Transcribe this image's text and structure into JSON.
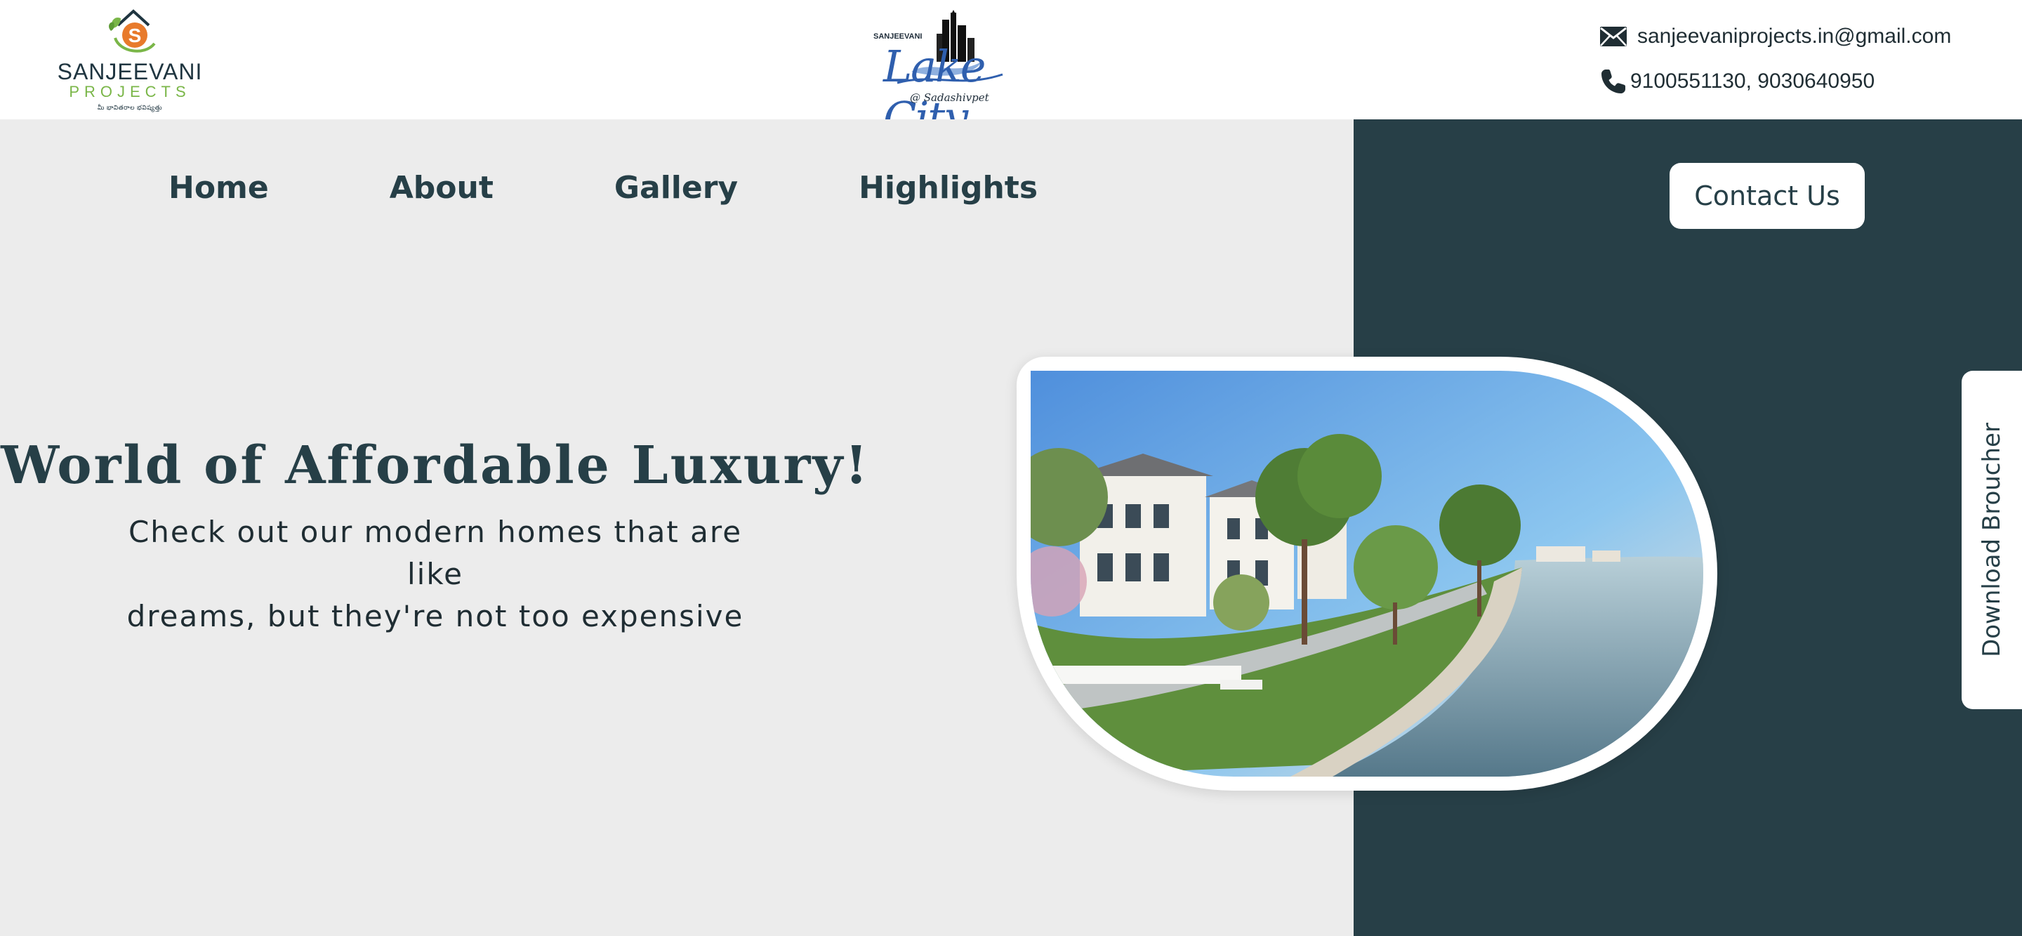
{
  "brand": {
    "name": "SANJEEVANI",
    "sub": "PROJECTS",
    "tagline": "మీ భావితరాల భవిష్యత్తు",
    "logo_letter": "S"
  },
  "project_logo": {
    "small": "SANJEEVANI",
    "main": "Lake City",
    "location": "@ Sadashivpet"
  },
  "contact_info": {
    "email": "sanjeevaniprojects.in@gmail.com",
    "phone": "9100551130, 9030640950",
    "email_icon": "mail-icon",
    "phone_icon": "phone-icon"
  },
  "nav": {
    "items": [
      {
        "label": "Home"
      },
      {
        "label": "About"
      },
      {
        "label": "Gallery"
      },
      {
        "label": "Highlights"
      }
    ],
    "contact_button": "Contact Us"
  },
  "hero": {
    "headline": "World of Affordable Luxury!",
    "subtext_line1": "Check out our modern homes that are like",
    "subtext_line2": "dreams, but they're not too expensive"
  },
  "side_tab": {
    "label": "Download Broucher"
  },
  "colors": {
    "dark_teal": "#273f47",
    "light_gray": "#ececec",
    "brand_green": "#7ab648",
    "brand_orange": "#e87a2b",
    "lake_blue": "#2f5fae"
  }
}
